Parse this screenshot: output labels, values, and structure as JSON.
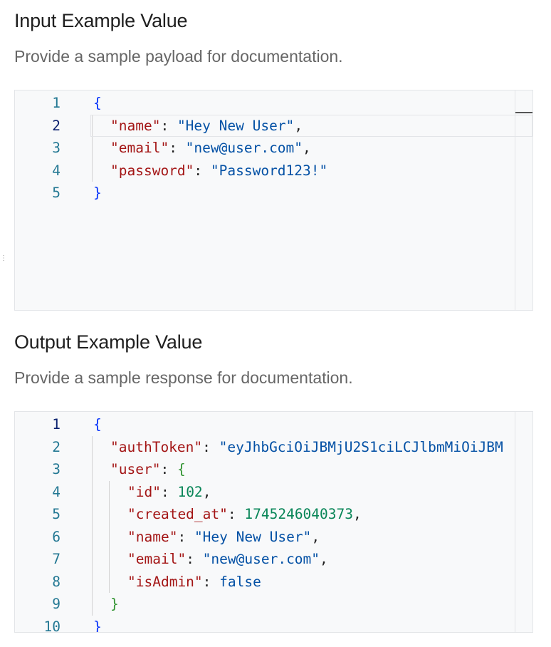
{
  "input_section": {
    "title": "Input Example Value",
    "description": "Provide a sample payload for documentation.",
    "lines": [
      {
        "num": "1",
        "tokens": [
          {
            "t": "{",
            "c": "tok-brace"
          }
        ]
      },
      {
        "num": "2",
        "tokens": [
          {
            "t": "\"name\"",
            "c": "tok-key"
          },
          {
            "t": ": ",
            "c": "tok-punct"
          },
          {
            "t": "\"Hey New User\"",
            "c": "tok-str"
          },
          {
            "t": ",",
            "c": "tok-punct"
          }
        ]
      },
      {
        "num": "3",
        "tokens": [
          {
            "t": "\"email\"",
            "c": "tok-key"
          },
          {
            "t": ": ",
            "c": "tok-punct"
          },
          {
            "t": "\"new@user.com\"",
            "c": "tok-str"
          },
          {
            "t": ",",
            "c": "tok-punct"
          }
        ]
      },
      {
        "num": "4",
        "tokens": [
          {
            "t": "\"password\"",
            "c": "tok-key"
          },
          {
            "t": ": ",
            "c": "tok-punct"
          },
          {
            "t": "\"Password123!\"",
            "c": "tok-str"
          }
        ]
      },
      {
        "num": "5",
        "tokens": [
          {
            "t": "}",
            "c": "tok-brace"
          }
        ]
      }
    ]
  },
  "output_section": {
    "title": "Output Example Value",
    "description": "Provide a sample response for documentation.",
    "lines": [
      {
        "num": "1",
        "tokens": [
          {
            "t": "{",
            "c": "tok-brace"
          }
        ]
      },
      {
        "num": "2",
        "tokens": [
          {
            "t": "\"authToken\"",
            "c": "tok-key"
          },
          {
            "t": ": ",
            "c": "tok-punct"
          },
          {
            "t": "\"eyJhbGciOiJBMjU2S1ciLCJlbmMiOiJBM",
            "c": "tok-str"
          }
        ]
      },
      {
        "num": "3",
        "tokens": [
          {
            "t": "\"user\"",
            "c": "tok-key"
          },
          {
            "t": ": ",
            "c": "tok-punct"
          },
          {
            "t": "{",
            "c": "tok-brace2"
          }
        ]
      },
      {
        "num": "4",
        "tokens": [
          {
            "t": "\"id\"",
            "c": "tok-key"
          },
          {
            "t": ": ",
            "c": "tok-punct"
          },
          {
            "t": "102",
            "c": "tok-num"
          },
          {
            "t": ",",
            "c": "tok-punct"
          }
        ]
      },
      {
        "num": "5",
        "tokens": [
          {
            "t": "\"created_at\"",
            "c": "tok-key"
          },
          {
            "t": ": ",
            "c": "tok-punct"
          },
          {
            "t": "1745246040373",
            "c": "tok-num"
          },
          {
            "t": ",",
            "c": "tok-punct"
          }
        ]
      },
      {
        "num": "6",
        "tokens": [
          {
            "t": "\"name\"",
            "c": "tok-key"
          },
          {
            "t": ": ",
            "c": "tok-punct"
          },
          {
            "t": "\"Hey New User\"",
            "c": "tok-str"
          },
          {
            "t": ",",
            "c": "tok-punct"
          }
        ]
      },
      {
        "num": "7",
        "tokens": [
          {
            "t": "\"email\"",
            "c": "tok-key"
          },
          {
            "t": ": ",
            "c": "tok-punct"
          },
          {
            "t": "\"new@user.com\"",
            "c": "tok-str"
          },
          {
            "t": ",",
            "c": "tok-punct"
          }
        ]
      },
      {
        "num": "8",
        "tokens": [
          {
            "t": "\"isAdmin\"",
            "c": "tok-key"
          },
          {
            "t": ": ",
            "c": "tok-punct"
          },
          {
            "t": "false",
            "c": "tok-bool"
          }
        ]
      },
      {
        "num": "9",
        "tokens": [
          {
            "t": "}",
            "c": "tok-brace2"
          }
        ]
      },
      {
        "num": "10",
        "tokens": [
          {
            "t": "}",
            "c": "tok-brace"
          }
        ]
      }
    ]
  }
}
